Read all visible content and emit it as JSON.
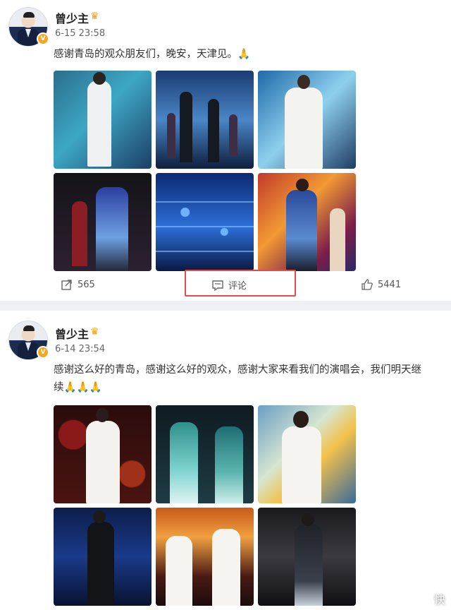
{
  "posts": [
    {
      "user": "曾少主",
      "crown_icon": "crown-icon",
      "verified_icon": "verified-icon",
      "time": "6-15 23:58",
      "text": "感谢青岛的观众朋友们，晚安，天津见。🙏",
      "actions": {
        "share_count": "565",
        "comment_label": "评论",
        "like_count": "5441"
      }
    },
    {
      "user": "曾少主",
      "crown_icon": "crown-icon",
      "verified_icon": "verified-icon",
      "time": "6-14 23:54",
      "text_line1": "感谢这么好的青岛，感谢这么好的观众，感谢大家来看我们的演唱会，我们明天继",
      "text_line2": "续🙏🙏🙏"
    }
  ],
  "watermark": "快"
}
